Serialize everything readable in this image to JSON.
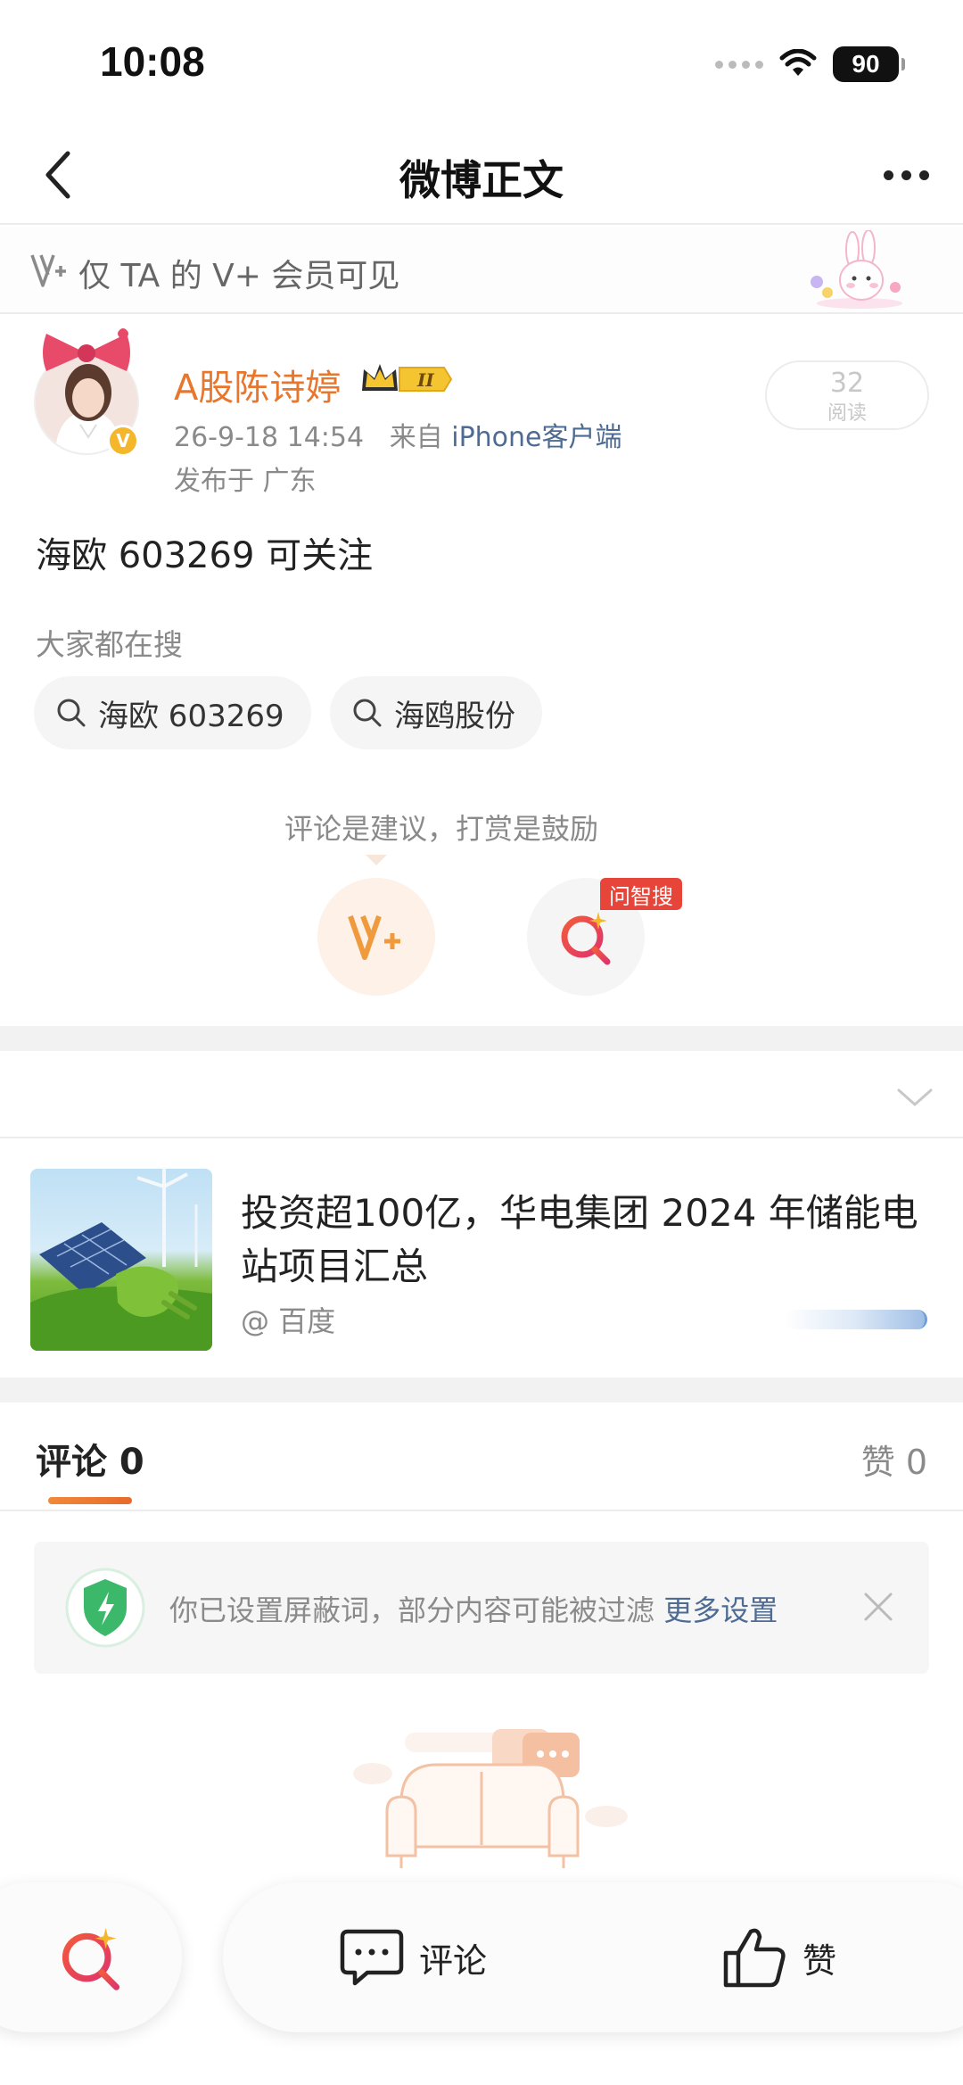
{
  "status_bar": {
    "time": "10:08",
    "battery": "90"
  },
  "nav": {
    "title": "微博正文"
  },
  "vip_banner": {
    "text": "仅 TA 的 V+ 会员可见"
  },
  "post": {
    "author": "A股陈诗婷",
    "timestamp": "26-9-18 14:54",
    "source_prefix": "来自",
    "source": "iPhone客户端",
    "location": "发布于 广东",
    "read_count": "32",
    "read_label": "阅读",
    "body": "海欧 603269 可关注"
  },
  "hot_search": {
    "heading": "大家都在搜",
    "chips": [
      "海欧 603269",
      "海鸥股份"
    ]
  },
  "reward": {
    "hint": "评论是建议，打赏是鼓励",
    "zhisou_tag": "问智搜"
  },
  "link_card": {
    "title": "投资超100亿，华电集团 2024 年储能电站项目汇总",
    "source": "@ 百度"
  },
  "comments": {
    "tab_label": "评论 0",
    "likes_label": "赞 0"
  },
  "filter_notice": {
    "text": "你已设置屏蔽词，部分内容可能被过滤",
    "link": "更多设置"
  },
  "bottom_bar": {
    "comment_label": "评论",
    "like_label": "赞"
  },
  "colors": {
    "accent_orange": "#e8762c",
    "link_blue": "#4e6b93",
    "tag_red": "#e8453a",
    "shield_green": "#3bb86a"
  }
}
